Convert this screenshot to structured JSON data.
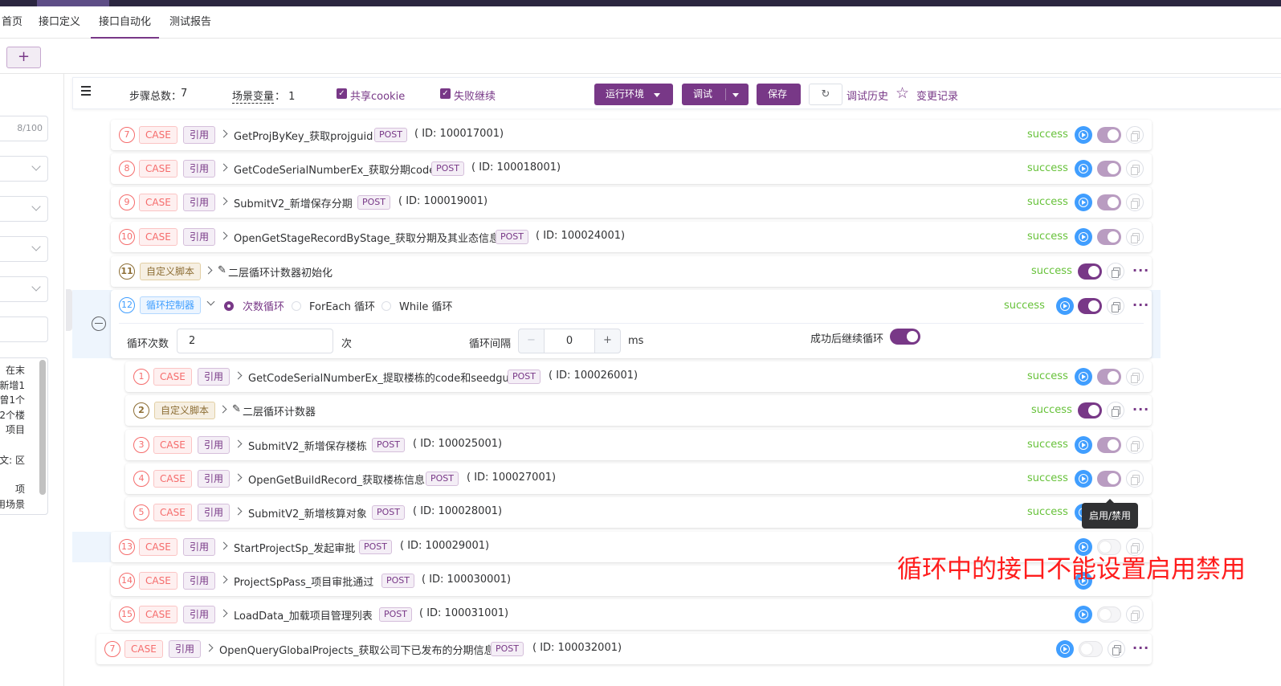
{
  "nav": {
    "tabs": [
      {
        "label": "首页",
        "active": false
      },
      {
        "label": "接口定义",
        "active": false
      },
      {
        "label": "接口自动化",
        "active": true
      },
      {
        "label": "测试报告",
        "active": false
      }
    ]
  },
  "add_button": "+",
  "left": {
    "name_count": "8/100",
    "desc_lines": [
      "在末",
      "新增1",
      "曾1个",
      "2个楼",
      "项目",
      "",
      "文: 区",
      "",
      "项",
      "用场景"
    ]
  },
  "toolbar": {
    "steps_label": "步骤总数：",
    "steps_value": "7",
    "vars_label": "场景变量",
    "vars_value": "：  1",
    "share_cookie": "共享cookie",
    "continue_fail": "失败继续",
    "env_button": "运行环境",
    "debug_button": "调试",
    "save_button": "保存",
    "history": "调试历史",
    "changelog": "变更记录"
  },
  "labels": {
    "case": "CASE",
    "ref": "引用",
    "script": "自定义脚本",
    "loop": "循环控制器",
    "post": "POST",
    "success": "success"
  },
  "steps_top": [
    {
      "num": "7",
      "name": "GetProjByKey_获取projguid",
      "id": "( ID: 100017001)",
      "status": "success"
    },
    {
      "num": "8",
      "name": "GetCodeSerialNumberEx_获取分期code",
      "id": "( ID: 100018001)",
      "status": "success"
    },
    {
      "num": "9",
      "name": "SubmitV2_新增保存分期",
      "id": "( ID: 100019001)",
      "status": "success"
    },
    {
      "num": "10",
      "name": "OpenGetStageRecordByStage_获取分期及其业态信息",
      "id": "( ID: 100024001)",
      "status": "success"
    }
  ],
  "script11": {
    "num": "11",
    "name": "二层循环计数器初始化",
    "status": "success"
  },
  "loop": {
    "num": "12",
    "mode_count": "次数循环",
    "mode_foreach": "ForEach 循环",
    "mode_while": "While 循环",
    "status": "success",
    "count_label": "循环次数",
    "count_value": "2",
    "count_unit": "次",
    "interval_label": "循环间隔",
    "interval_value": "0",
    "interval_unit": "ms",
    "continue_label": "成功后继续循环",
    "minus": "−",
    "plus": "+"
  },
  "loop_children": [
    {
      "num": "1",
      "type": "case",
      "name": "GetCodeSerialNumberEx_提取楼栋的code和seedguid",
      "id": "( ID: 100026001)",
      "status": "success"
    },
    {
      "num": "2",
      "type": "script",
      "name": "二层循环计数器",
      "id": "",
      "status": "success"
    },
    {
      "num": "3",
      "type": "case",
      "name": "SubmitV2_新增保存楼栋",
      "id": "( ID: 100025001)",
      "status": "success"
    },
    {
      "num": "4",
      "type": "case",
      "name": "OpenGetBuildRecord_获取楼栋信息",
      "id": "( ID: 100027001)",
      "status": "success"
    },
    {
      "num": "5",
      "type": "case",
      "name": "SubmitV2_新增核算对象",
      "id": "( ID: 100028001)",
      "status": "success"
    }
  ],
  "steps_bottom": [
    {
      "num": "13",
      "name": "StartProjectSp_发起审批",
      "id": "( ID: 100029001)"
    },
    {
      "num": "14",
      "name": "ProjectSpPass_项目审批通过",
      "id": "( ID: 100030001)"
    },
    {
      "num": "15",
      "name": "LoadData_加载项目管理列表",
      "id": "( ID: 100031001)"
    }
  ],
  "last_step": {
    "num": "7",
    "name": "OpenQueryGlobalProjects_获取公司下已发布的分期信息",
    "id": "( ID: 100032001)"
  },
  "tooltip": "启用/禁用",
  "annotation": "循环中的接口不能设置启用禁用",
  "colors": {
    "primary": "#783887",
    "success": "#67c23a",
    "danger": "#f56c6c",
    "info": "#409eff",
    "annotation": "#ff1d1d"
  }
}
